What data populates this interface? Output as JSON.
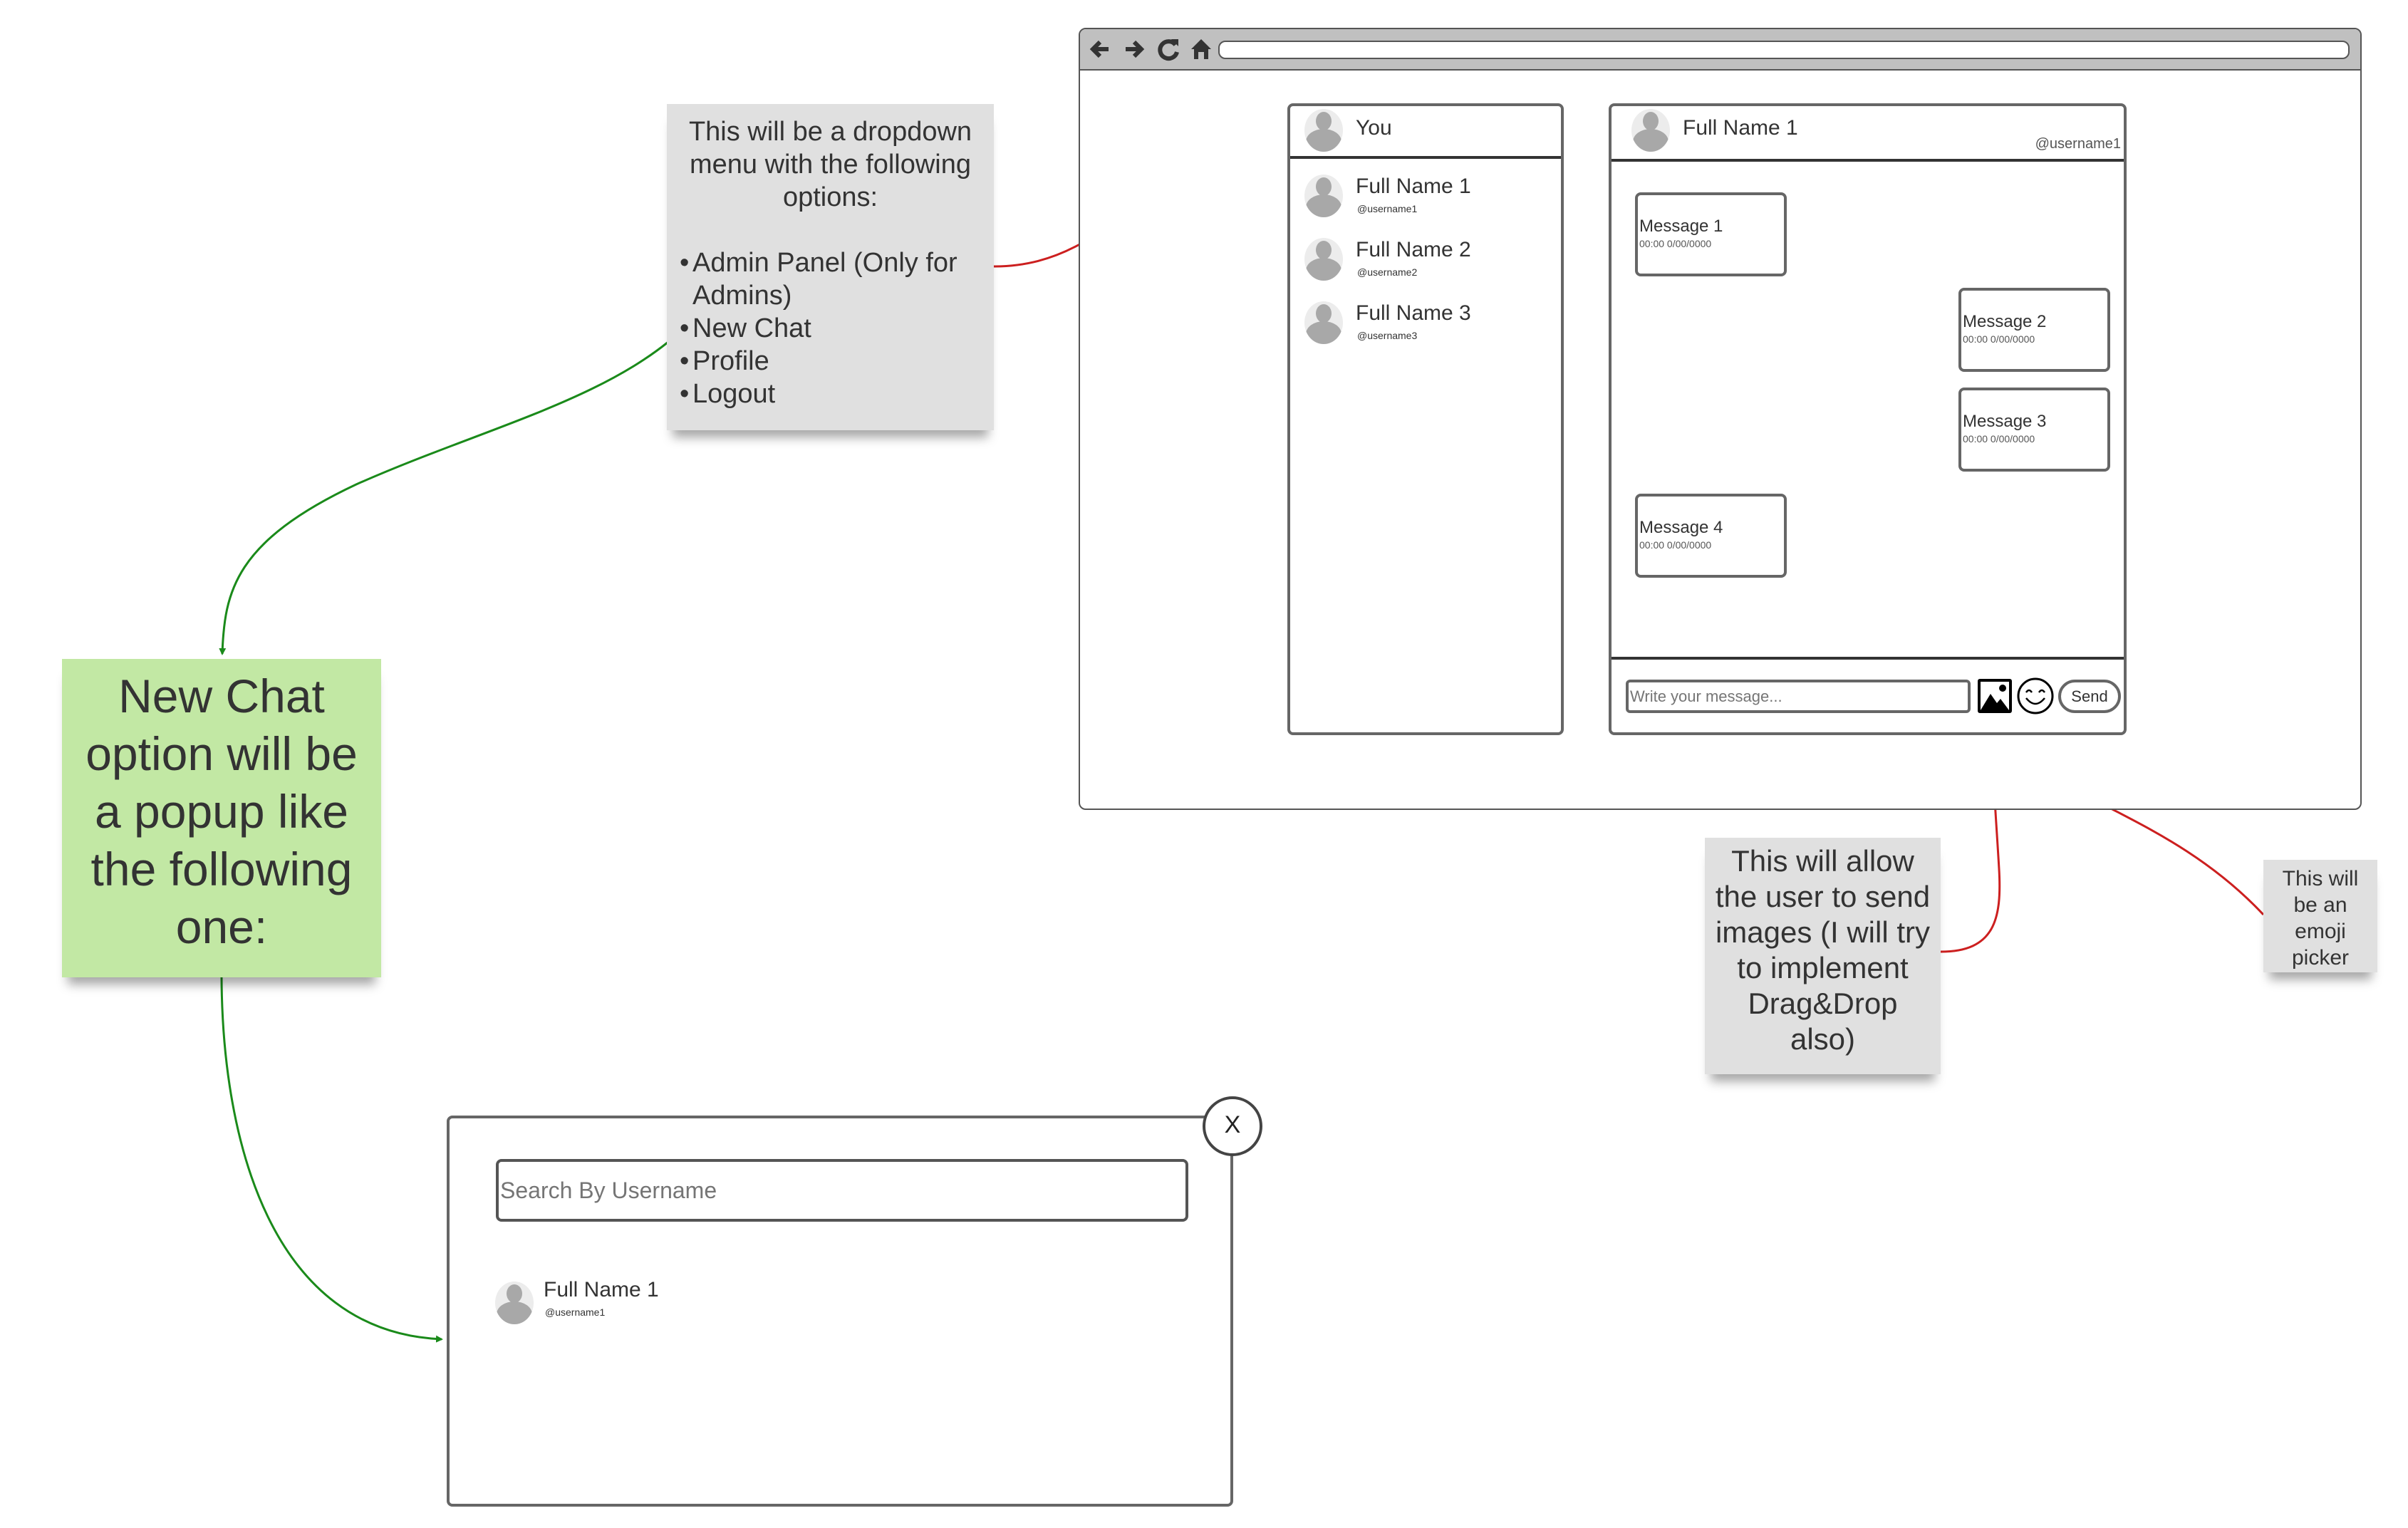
{
  "browser": {
    "nav_icons": [
      "back-arrow-icon",
      "forward-arrow-icon",
      "reload-icon",
      "home-icon"
    ],
    "url": ""
  },
  "sidebar": {
    "current_user": "You",
    "contacts": [
      {
        "name": "Full Name 1",
        "username": "@username1"
      },
      {
        "name": "Full Name 2",
        "username": "@username2"
      },
      {
        "name": "Full Name 3",
        "username": "@username3"
      }
    ]
  },
  "chat": {
    "header_name": "Full Name 1",
    "header_username": "@username1",
    "messages": [
      {
        "text": "Message 1",
        "timestamp": "00:00 0/00/0000",
        "side": "left"
      },
      {
        "text": "Message 2",
        "timestamp": "00:00 0/00/0000",
        "side": "right"
      },
      {
        "text": "Message 3",
        "timestamp": "00:00 0/00/0000",
        "side": "right"
      },
      {
        "text": "Message 4",
        "timestamp": "00:00 0/00/0000",
        "side": "left"
      }
    ],
    "composer_placeholder": "Write your message...",
    "send_label": "Send"
  },
  "notes": {
    "dropdown": {
      "title": "This will be a dropdown menu with the following options:",
      "options": [
        "Admin Panel (Only for Admins)",
        "New Chat",
        "Profile",
        "Logout"
      ]
    },
    "new_chat": "New Chat option will be a popup like the following one:",
    "image_upload": "This will allow the user to send images (I will try to implement Drag&Drop also)",
    "emoji": "This will be an emoji picker"
  },
  "popup": {
    "close_label": "X",
    "search_placeholder": "Search By Username",
    "results": [
      {
        "name": "Full Name 1",
        "username": "@username1"
      }
    ]
  },
  "colors": {
    "note_gray": "#e0e0e0",
    "note_green": "#c2e8a4",
    "arrow_red": "#cc1f1f",
    "arrow_green": "#1a8a1a",
    "toolbar_gray": "#c0c0c0",
    "border": "#666666"
  }
}
